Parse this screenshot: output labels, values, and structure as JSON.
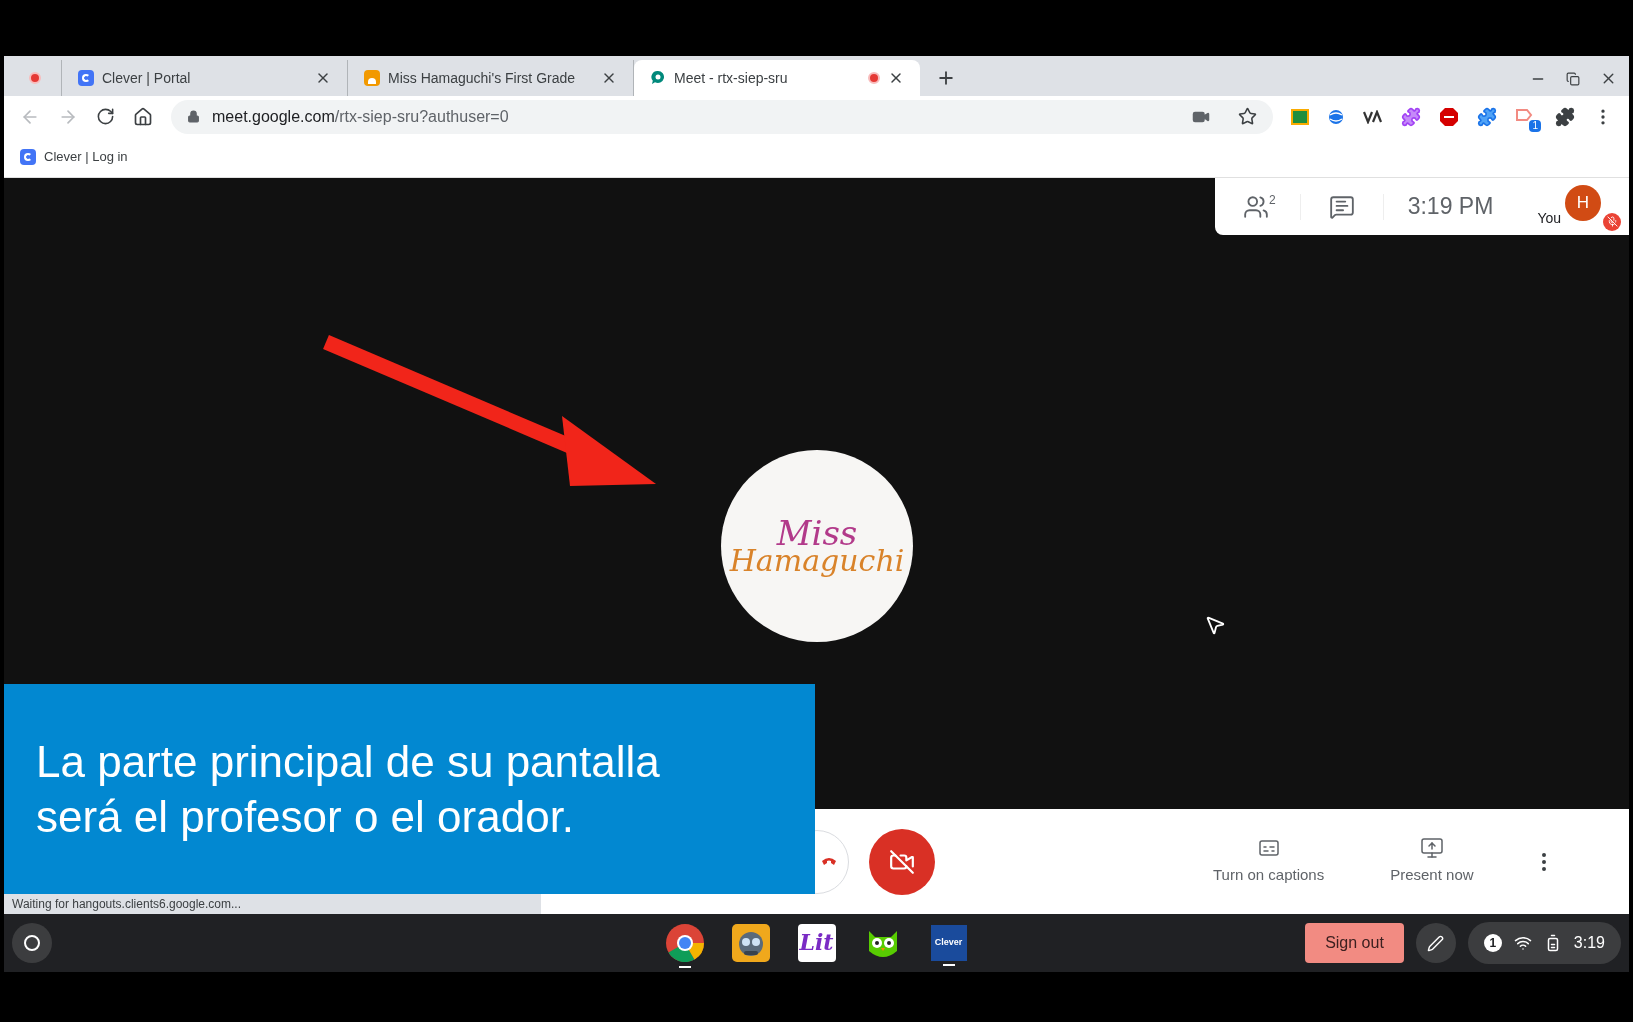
{
  "tabs": [
    {
      "kind": "pinned",
      "recording": true,
      "selected": false
    },
    {
      "kind": "clever",
      "title": "Clever | Portal",
      "recording": false,
      "selected": false
    },
    {
      "kind": "classroom",
      "title": "Miss Hamaguchi's First Grade",
      "recording": false,
      "selected": false
    },
    {
      "kind": "meet",
      "title": "Meet - rtx-siep-sru",
      "recording": true,
      "selected": true
    }
  ],
  "address": {
    "host": "meet.google.com",
    "path": "/rtx-siep-sru?authuser=0",
    "extension_badge": "1"
  },
  "bookmarks": [
    {
      "label": "Clever | Log in"
    }
  ],
  "meet": {
    "participant_count": "2",
    "time": "3:19 PM",
    "self_label": "You",
    "avatar_initial": "H",
    "mic_muted": true,
    "tile_logo": [
      "Miss",
      "Hamaguchi"
    ],
    "camera_on": false,
    "actions": [
      {
        "kind": "captions",
        "label": "Turn on captions"
      },
      {
        "kind": "present",
        "label": "Present now"
      }
    ]
  },
  "caption_overlay": "La parte principal de su pantalla\nserá el profesor o el orador.",
  "status_text": "Waiting for hangouts.clients6.google.com...",
  "shelf": {
    "apps": [
      {
        "kind": "chrome",
        "active": true
      },
      {
        "kind": "robot",
        "active": false
      },
      {
        "kind": "lit",
        "label": "Lit",
        "active": false
      },
      {
        "kind": "owl",
        "active": false
      },
      {
        "kind": "clever",
        "label": "Clever",
        "active": true
      }
    ],
    "sign_out": "Sign out",
    "notification_count": "1",
    "time": "3:19"
  }
}
